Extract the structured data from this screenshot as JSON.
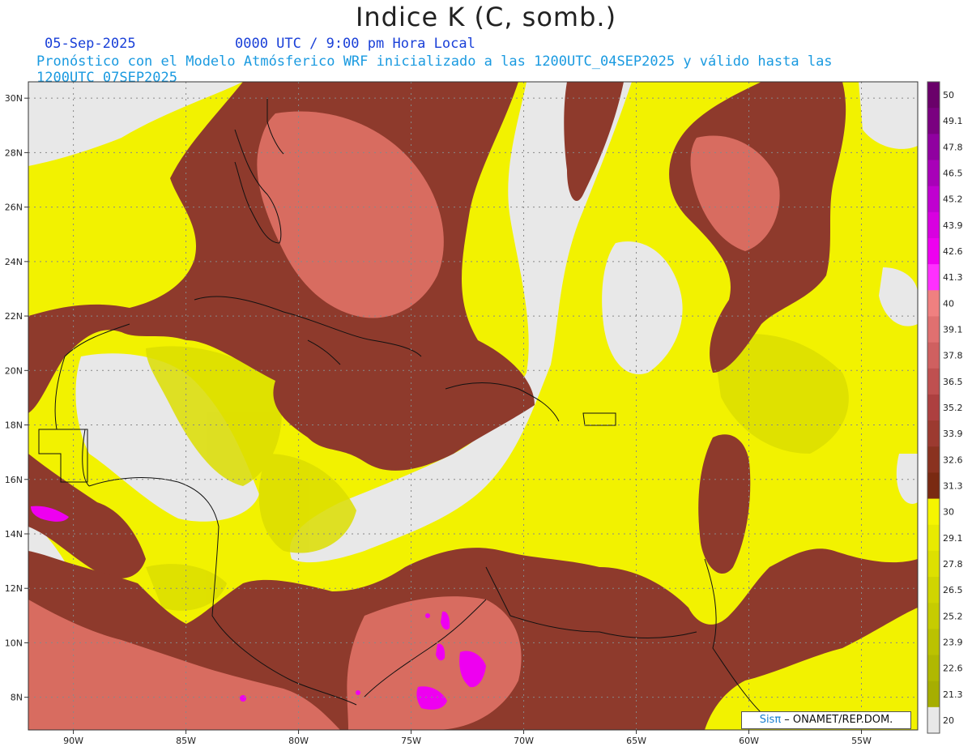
{
  "title": "Indice K (C, somb.)",
  "date": "05-Sep-2025",
  "time_label": "0000 UTC / 9:00 pm Hora Local",
  "valid_label": "Pronóstico con el Modelo Atmósferico WRF inicializado a las 1200UTC_04SEP2025 y válido hasta las  1200UTC_07SEP2025",
  "credit": {
    "brand": "Sisπ",
    "org": " – ONAMET/REP.DOM."
  },
  "lat_ticks": [
    "30N",
    "28N",
    "26N",
    "24N",
    "22N",
    "20N",
    "18N",
    "16N",
    "14N",
    "12N",
    "10N",
    "8N"
  ],
  "lat_values": [
    30,
    28,
    26,
    24,
    22,
    20,
    18,
    16,
    14,
    12,
    10,
    8
  ],
  "lon_ticks": [
    "90W",
    "85W",
    "80W",
    "75W",
    "70W",
    "65W",
    "60W",
    "55W"
  ],
  "lon_values": [
    -90,
    -85,
    -80,
    -75,
    -70,
    -65,
    -60,
    -55
  ],
  "extent": {
    "lon_min": -92,
    "lon_max": -52.5,
    "lat_min": 6.8,
    "lat_max": 30.6
  },
  "colorbar": {
    "labels": [
      "50",
      "49.1",
      "47.8",
      "46.5",
      "45.2",
      "43.9",
      "42.6",
      "41.3",
      "40",
      "39.1",
      "37.8",
      "36.5",
      "35.2",
      "33.9",
      "32.6",
      "31.3",
      "30",
      "29.1",
      "27.8",
      "26.5",
      "25.2",
      "23.9",
      "22.6",
      "21.3",
      "20"
    ],
    "colors": [
      "#6a006a",
      "#7a0080",
      "#9000a0",
      "#a800b8",
      "#c000d0",
      "#d800e0",
      "#ee00f0",
      "#ff30ff",
      "#f08080",
      "#e07070",
      "#cf6060",
      "#bf5050",
      "#ad4040",
      "#9c3a30",
      "#8a3220",
      "#7a2a12",
      "#f5f500",
      "#e8ea00",
      "#dde000",
      "#d0d500",
      "#c6cc00",
      "#bbc200",
      "#b0b800",
      "#a6ae00",
      "#e8e8e8"
    ]
  },
  "colors": {
    "no_data": "#e8e8e8",
    "yellow": "#f2f200",
    "olive": "#d6d800",
    "brown": "#8e3a2c",
    "salmon": "#d86c60",
    "magenta": "#ee00f0"
  }
}
